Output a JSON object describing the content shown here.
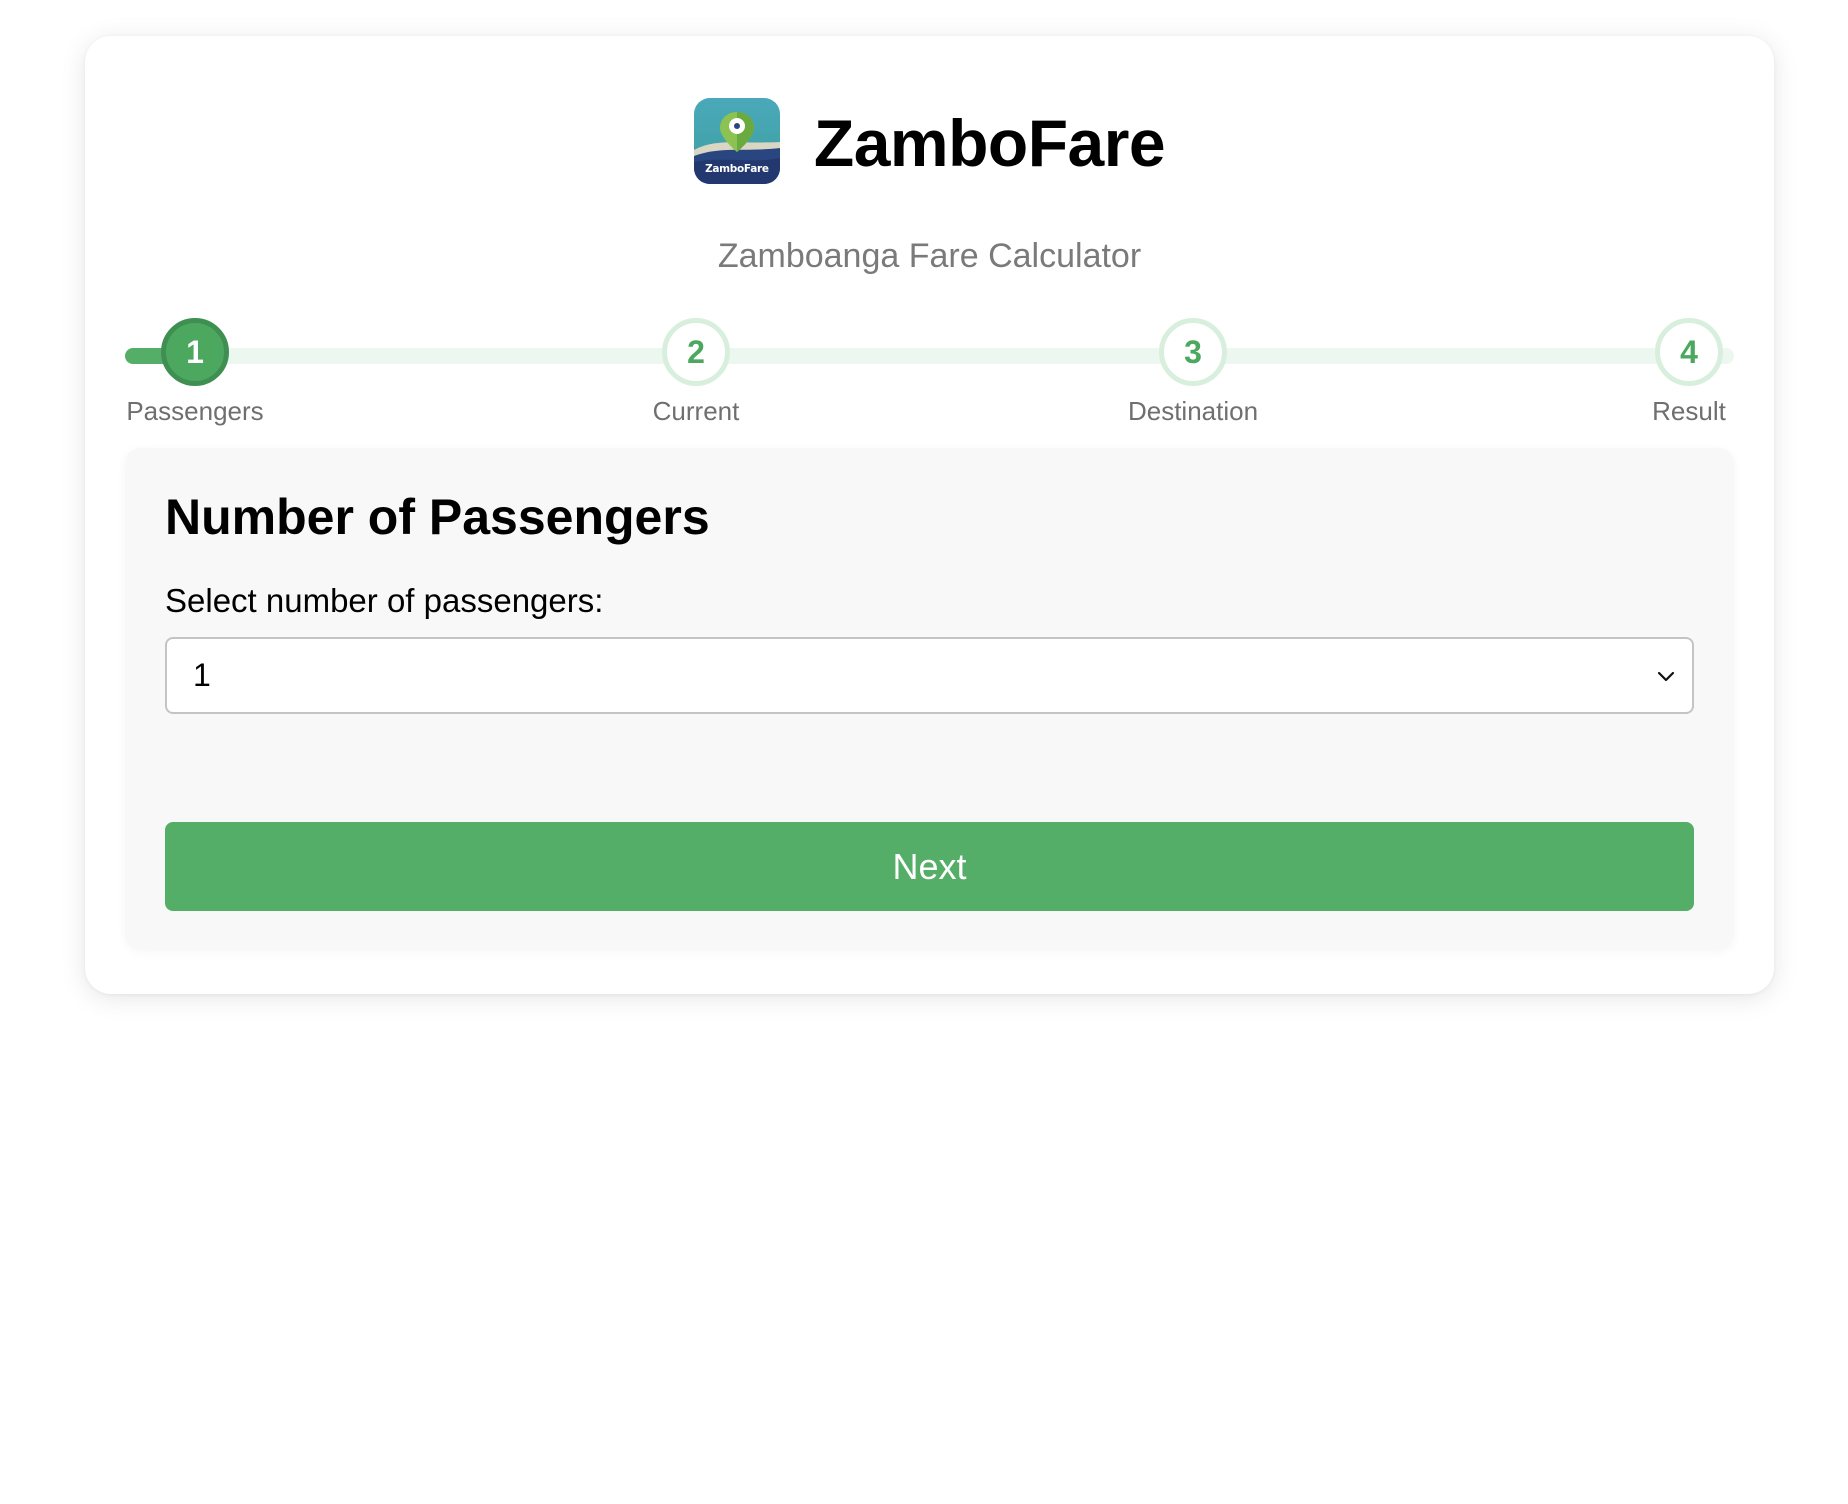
{
  "app": {
    "title": "ZamboFare",
    "subtitle": "Zamboanga Fare Calculator",
    "icon_label": "ZamboFare"
  },
  "stepper": {
    "current_step": 1,
    "steps": [
      {
        "number": "1",
        "label": "Passengers",
        "state": "active"
      },
      {
        "number": "2",
        "label": "Current",
        "state": "pending"
      },
      {
        "number": "3",
        "label": "Destination",
        "state": "pending"
      },
      {
        "number": "4",
        "label": "Result",
        "state": "pending"
      }
    ]
  },
  "form": {
    "title": "Number of Passengers",
    "select_label": "Select number of passengers:",
    "select_value": "1",
    "next_label": "Next"
  },
  "colors": {
    "accent": "#55ae67",
    "active_step": "#4ca75f",
    "track": "#ecf7ef",
    "icon_top": "#3fa3ae",
    "icon_bottom": "#22386f"
  },
  "icons": {
    "app_logo": "map-pin-logo-icon",
    "select_arrow": "chevron-down-icon"
  }
}
